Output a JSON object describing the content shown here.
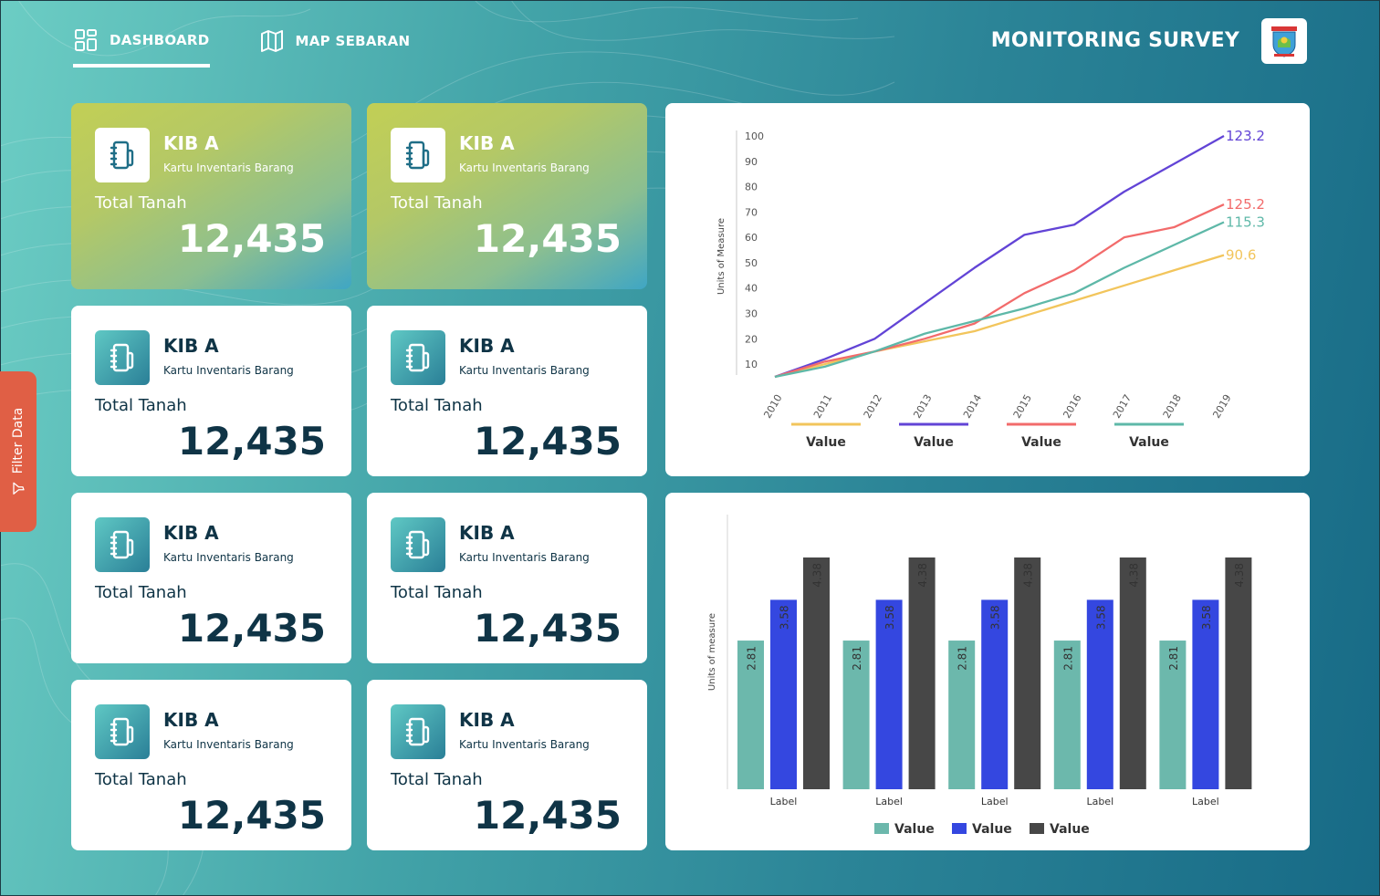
{
  "nav": {
    "items": [
      {
        "label": "DASHBOARD",
        "icon": "dashboard-grid-icon",
        "active": true
      },
      {
        "label": "MAP SEBARAN",
        "icon": "map-icon",
        "active": false
      }
    ]
  },
  "header": {
    "title": "MONITORING SURVEY",
    "logo_icon": "regional-emblem-logo"
  },
  "filter": {
    "label": "Filter Data",
    "icon": "filter-icon"
  },
  "cards": [
    {
      "title": "KIB A",
      "subtitle": "Kartu Inventaris Barang",
      "metric_label": "Total Tanah",
      "value": "12,435",
      "highlight": true
    },
    {
      "title": "KIB A",
      "subtitle": "Kartu Inventaris Barang",
      "metric_label": "Total Tanah",
      "value": "12,435",
      "highlight": true
    },
    {
      "title": "KIB A",
      "subtitle": "Kartu Inventaris Barang",
      "metric_label": "Total Tanah",
      "value": "12,435",
      "highlight": false
    },
    {
      "title": "KIB A",
      "subtitle": "Kartu Inventaris Barang",
      "metric_label": "Total Tanah",
      "value": "12,435",
      "highlight": false
    },
    {
      "title": "KIB A",
      "subtitle": "Kartu Inventaris Barang",
      "metric_label": "Total Tanah",
      "value": "12,435",
      "highlight": false
    },
    {
      "title": "KIB A",
      "subtitle": "Kartu Inventaris Barang",
      "metric_label": "Total Tanah",
      "value": "12,435",
      "highlight": false
    },
    {
      "title": "KIB A",
      "subtitle": "Kartu Inventaris Barang",
      "metric_label": "Total Tanah",
      "value": "12,435",
      "highlight": false
    },
    {
      "title": "KIB A",
      "subtitle": "Kartu Inventaris Barang",
      "metric_label": "Total Tanah",
      "value": "12,435",
      "highlight": false
    }
  ],
  "chart_data": [
    {
      "type": "line",
      "ylabel": "Units of Measure",
      "ylim": [
        5,
        100
      ],
      "yticks": [
        10,
        20,
        30,
        40,
        50,
        60,
        70,
        80,
        90,
        100
      ],
      "x": [
        "2010",
        "2011",
        "2012",
        "2013",
        "2014",
        "2015",
        "2016",
        "2017",
        "2018",
        "2019"
      ],
      "series": [
        {
          "name": "Value",
          "color": "#f2c55c",
          "values": [
            5,
            10,
            15,
            19,
            23,
            29,
            35,
            41,
            47,
            53
          ],
          "end_label": "90.6"
        },
        {
          "name": "Value",
          "color": "#6244d6",
          "values": [
            5,
            12,
            20,
            34,
            48,
            61,
            65,
            78,
            89,
            100
          ],
          "end_label": "123.2"
        },
        {
          "name": "Value",
          "color": "#f26b6b",
          "values": [
            5,
            11,
            15,
            20,
            26,
            38,
            47,
            60,
            64,
            73
          ],
          "end_label": "125.2"
        },
        {
          "name": "Value",
          "color": "#5eb8a8",
          "values": [
            5,
            9,
            15,
            22,
            27,
            32,
            38,
            48,
            57,
            66
          ],
          "end_label": "115.3"
        }
      ],
      "legend_position": "bottom"
    },
    {
      "type": "bar",
      "ylabel": "Units of measure",
      "ylim": [
        0,
        5
      ],
      "categories": [
        "Label",
        "Label",
        "Label",
        "Label",
        "Label"
      ],
      "series": [
        {
          "name": "Value",
          "color": "#6cb8ac",
          "values": [
            2.81,
            2.81,
            2.81,
            2.81,
            2.81
          ]
        },
        {
          "name": "Value",
          "color": "#3447e0",
          "values": [
            3.58,
            3.58,
            3.58,
            3.58,
            3.58
          ]
        },
        {
          "name": "Value",
          "color": "#474747",
          "values": [
            4.38,
            4.38,
            4.38,
            4.38,
            4.38
          ]
        }
      ],
      "legend_position": "bottom"
    }
  ]
}
